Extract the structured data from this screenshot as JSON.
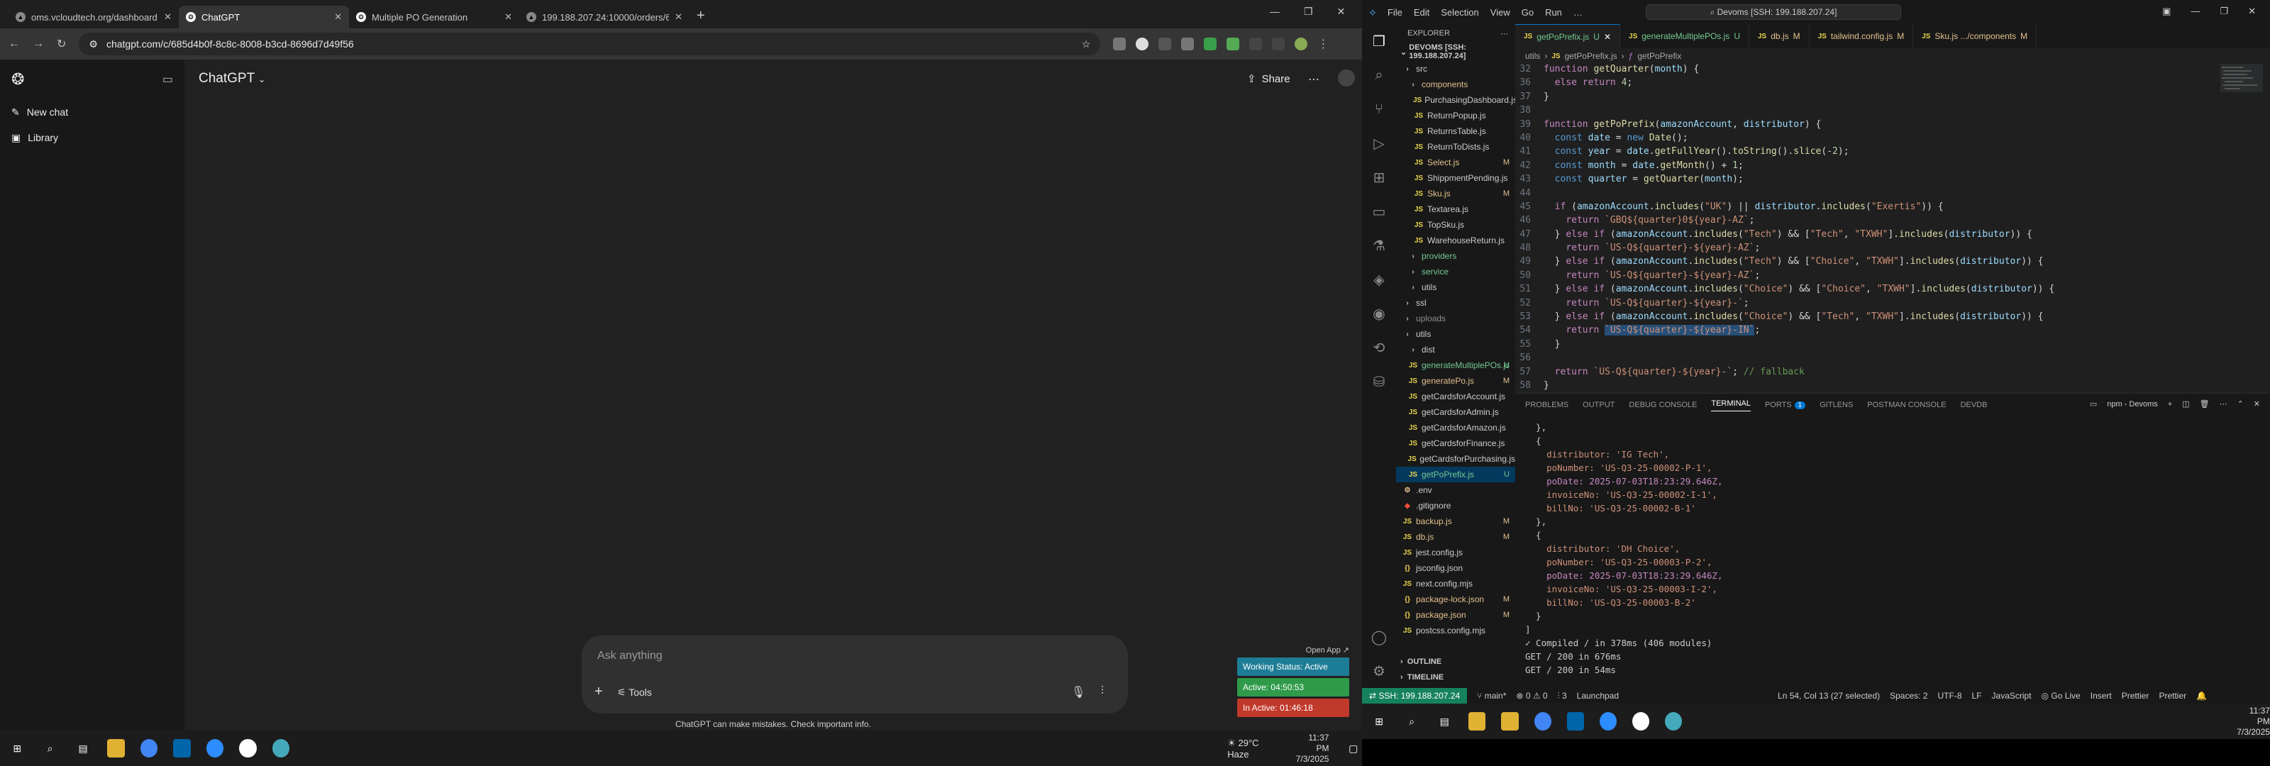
{
  "browser": {
    "tabs": [
      {
        "label": "oms.vcloudtech.org/dashboard",
        "active": false
      },
      {
        "label": "ChatGPT",
        "active": true
      },
      {
        "label": "Multiple PO Generation",
        "active": false
      },
      {
        "label": "199.188.207.24:10000/orders/6",
        "active": false
      }
    ],
    "url": "chatgpt.com/c/685d4b0f-8c8c-8008-b3cd-8696d7d49f56"
  },
  "chatgpt": {
    "sidebar": [
      {
        "label": "New chat"
      },
      {
        "label": "Library"
      }
    ],
    "title": "ChatGPT",
    "share_label": "Share",
    "prompt_placeholder": "Ask anything",
    "tools_label": "Tools",
    "disclaimer": "ChatGPT can make mistakes. Check important info."
  },
  "work_status": {
    "open_app": "Open App",
    "status": "Working Status: Active",
    "active": "Active: 04:50:53",
    "inactive": "In Active: 01:46:18"
  },
  "left_taskbar": {
    "weather": "29°C  Haze",
    "time": "11:37 PM",
    "date": "7/3/2025"
  },
  "vscode": {
    "menu": [
      "File",
      "Edit",
      "Selection",
      "View",
      "Go",
      "Run",
      "…"
    ],
    "search": "Devoms [SSH: 199.188.207.24]",
    "explorer_title": "EXPLORER",
    "workspace": "DEVOMS [SSH: 199.188.207.24]",
    "tree": [
      {
        "label": "src",
        "type": "folder",
        "depth": 0,
        "badge": "",
        "color": "#cccccc"
      },
      {
        "label": "components",
        "type": "folder",
        "depth": 1,
        "badge": "",
        "color": "#e2c08d"
      },
      {
        "label": "PurchasingDashboard.js",
        "type": "js",
        "depth": 2,
        "badge": "",
        "color": "#cccccc"
      },
      {
        "label": "ReturnPopup.js",
        "type": "js",
        "depth": 2,
        "badge": "",
        "color": "#cccccc"
      },
      {
        "label": "ReturnsTable.js",
        "type": "js",
        "depth": 2,
        "badge": "",
        "color": "#cccccc"
      },
      {
        "label": "ReturnToDists.js",
        "type": "js",
        "depth": 2,
        "badge": "",
        "color": "#cccccc"
      },
      {
        "label": "Select.js",
        "type": "js",
        "depth": 2,
        "badge": "M",
        "color": "#e2c08d"
      },
      {
        "label": "ShippmentPending.js",
        "type": "js",
        "depth": 2,
        "badge": "",
        "color": "#cccccc"
      },
      {
        "label": "Sku.js",
        "type": "js",
        "depth": 2,
        "badge": "M",
        "color": "#e2c08d"
      },
      {
        "label": "Textarea.js",
        "type": "js",
        "depth": 2,
        "badge": "",
        "color": "#cccccc"
      },
      {
        "label": "TopSku.js",
        "type": "js",
        "depth": 2,
        "badge": "",
        "color": "#cccccc"
      },
      {
        "label": "WarehouseReturn.js",
        "type": "js",
        "depth": 2,
        "badge": "",
        "color": "#cccccc"
      },
      {
        "label": "providers",
        "type": "folder",
        "depth": 1,
        "badge": "",
        "color": "#73c991"
      },
      {
        "label": "service",
        "type": "folder",
        "depth": 1,
        "badge": "",
        "color": "#73c991"
      },
      {
        "label": "utils",
        "type": "folder",
        "depth": 1,
        "badge": "",
        "color": "#cccccc"
      },
      {
        "label": "ssl",
        "type": "folder",
        "depth": 0,
        "badge": "",
        "color": "#cccccc"
      },
      {
        "label": "uploads",
        "type": "folder",
        "depth": 0,
        "badge": "",
        "color": "#8c8c8c"
      },
      {
        "label": "utils",
        "type": "folder",
        "depth": 0,
        "badge": "",
        "color": "#cccccc"
      },
      {
        "label": "dist",
        "type": "folder",
        "depth": 1,
        "badge": "",
        "color": "#cccccc"
      },
      {
        "label": "generateMultiplePOs.js",
        "type": "js",
        "depth": 1,
        "badge": "U",
        "color": "#73c991"
      },
      {
        "label": "generatePo.js",
        "type": "js",
        "depth": 1,
        "badge": "M",
        "color": "#e2c08d"
      },
      {
        "label": "getCardsforAccount.js",
        "type": "js",
        "depth": 1,
        "badge": "",
        "color": "#cccccc"
      },
      {
        "label": "getCardsforAdmin.js",
        "type": "js",
        "depth": 1,
        "badge": "",
        "color": "#cccccc"
      },
      {
        "label": "getCardsforAmazon.js",
        "type": "js",
        "depth": 1,
        "badge": "",
        "color": "#cccccc"
      },
      {
        "label": "getCardsforFinance.js",
        "type": "js",
        "depth": 1,
        "badge": "",
        "color": "#cccccc"
      },
      {
        "label": "getCardsforPurchasing.js",
        "type": "js",
        "depth": 1,
        "badge": "",
        "color": "#cccccc"
      },
      {
        "label": "getPoPrefix.js",
        "type": "js",
        "depth": 1,
        "badge": "U",
        "color": "#73c991",
        "selected": true
      },
      {
        "label": ".env",
        "type": "env",
        "depth": 0,
        "badge": "",
        "color": "#cccccc"
      },
      {
        "label": ".gitignore",
        "type": "git",
        "depth": 0,
        "badge": "",
        "color": "#cccccc"
      },
      {
        "label": "backup.js",
        "type": "js",
        "depth": 0,
        "badge": "M",
        "color": "#e2c08d"
      },
      {
        "label": "db.js",
        "type": "js",
        "depth": 0,
        "badge": "M",
        "color": "#e2c08d"
      },
      {
        "label": "jest.config.js",
        "type": "js",
        "depth": 0,
        "badge": "",
        "color": "#cccccc"
      },
      {
        "label": "jsconfig.json",
        "type": "json",
        "depth": 0,
        "badge": "",
        "color": "#cccccc"
      },
      {
        "label": "next.config.mjs",
        "type": "js",
        "depth": 0,
        "badge": "",
        "color": "#cccccc"
      },
      {
        "label": "package-lock.json",
        "type": "json",
        "depth": 0,
        "badge": "M",
        "color": "#e2c08d"
      },
      {
        "label": "package.json",
        "type": "json",
        "depth": 0,
        "badge": "M",
        "color": "#e2c08d"
      },
      {
        "label": "postcss.config.mjs",
        "type": "js",
        "depth": 0,
        "badge": "",
        "color": "#cccccc"
      }
    ],
    "outline": "OUTLINE",
    "timeline": "TIMELINE",
    "tabs": [
      {
        "label": "getPoPrefix.js",
        "badge": "U",
        "active": true
      },
      {
        "label": "generateMultiplePOs.js",
        "badge": "U",
        "active": false
      },
      {
        "label": "db.js",
        "badge": "M",
        "active": false
      },
      {
        "label": "tailwind.config.js",
        "badge": "M",
        "active": false
      },
      {
        "label": "Sku.js .../components",
        "badge": "M",
        "active": false
      }
    ],
    "breadcrumb": [
      "utils",
      "getPoPrefix.js",
      "getPoPrefix"
    ],
    "code": [
      {
        "n": "32",
        "html": "<span class='kw'>function</span> <span class='fn'>getQuarter</span>(<span class='vr'>month</span>) {"
      },
      {
        "n": "36",
        "html": "  <span class='kw'>else return</span> <span class='nm'>4</span>;"
      },
      {
        "n": "37",
        "html": "}"
      },
      {
        "n": "38",
        "html": ""
      },
      {
        "n": "39",
        "html": "<span class='kw'>function</span> <span class='fn'>getPoPrefix</span>(<span class='vr'>amazonAccount</span>, <span class='vr'>distributor</span>) {"
      },
      {
        "n": "40",
        "html": "  <span class='bk'>const</span> <span class='vr'>date</span> = <span class='bk'>new</span> <span class='fn'>Date</span>();"
      },
      {
        "n": "41",
        "html": "  <span class='bk'>const</span> <span class='vr'>year</span> = <span class='vr'>date</span>.<span class='fn'>getFullYear</span>().<span class='fn'>toString</span>().<span class='fn'>slice</span>(<span class='nm'>-2</span>);"
      },
      {
        "n": "42",
        "html": "  <span class='bk'>const</span> <span class='vr'>month</span> = <span class='vr'>date</span>.<span class='fn'>getMonth</span>() + <span class='nm'>1</span>;"
      },
      {
        "n": "43",
        "html": "  <span class='bk'>const</span> <span class='vr'>quarter</span> = <span class='fn'>getQuarter</span>(<span class='vr'>month</span>);"
      },
      {
        "n": "44",
        "html": ""
      },
      {
        "n": "45",
        "html": "  <span class='kw'>if</span> (<span class='vr'>amazonAccount</span>.<span class='fn'>includes</span>(<span class='st'>\"UK\"</span>) || <span class='vr'>distributor</span>.<span class='fn'>includes</span>(<span class='st'>\"Exertis\"</span>)) {"
      },
      {
        "n": "46",
        "html": "    <span class='kw'>return</span> <span class='st'>`GBQ${quarter}0${year}-AZ`</span>;"
      },
      {
        "n": "47",
        "html": "  } <span class='kw'>else if</span> (<span class='vr'>amazonAccount</span>.<span class='fn'>includes</span>(<span class='st'>\"Tech\"</span>) &amp;&amp; [<span class='st'>\"Tech\"</span>, <span class='st'>\"TXWH\"</span>].<span class='fn'>includes</span>(<span class='vr'>distributor</span>)) {"
      },
      {
        "n": "48",
        "html": "    <span class='kw'>return</span> <span class='st'>`US-Q${quarter}-${year}-AZ`</span>;"
      },
      {
        "n": "49",
        "html": "  } <span class='kw'>else if</span> (<span class='vr'>amazonAccount</span>.<span class='fn'>includes</span>(<span class='st'>\"Tech\"</span>) &amp;&amp; [<span class='st'>\"Choice\"</span>, <span class='st'>\"TXWH\"</span>].<span class='fn'>includes</span>(<span class='vr'>distributor</span>)) {"
      },
      {
        "n": "50",
        "html": "    <span class='kw'>return</span> <span class='st'>`US-Q${quarter}-${year}-AZ`</span>;"
      },
      {
        "n": "51",
        "html": "  } <span class='kw'>else if</span> (<span class='vr'>amazonAccount</span>.<span class='fn'>includes</span>(<span class='st'>\"Choice\"</span>) &amp;&amp; [<span class='st'>\"Choice\"</span>, <span class='st'>\"TXWH\"</span>].<span class='fn'>includes</span>(<span class='vr'>distributor</span>)) {"
      },
      {
        "n": "52",
        "html": "    <span class='kw'>return</span> <span class='st'>`US-Q${quarter}-${year}-`</span>;"
      },
      {
        "n": "53",
        "html": "  } <span class='kw'>else if</span> (<span class='vr'>amazonAccount</span>.<span class='fn'>includes</span>(<span class='st'>\"Choice\"</span>) &amp;&amp; [<span class='st'>\"Tech\"</span>, <span class='st'>\"TXWH\"</span>].<span class='fn'>includes</span>(<span class='vr'>distributor</span>)) {"
      },
      {
        "n": "54",
        "html": "    <span class='kw'>return</span> <span class='st' style='background:#264f78'>`US-Q${quarter}-${year}-IN`</span>;"
      },
      {
        "n": "55",
        "html": "  }"
      },
      {
        "n": "56",
        "html": ""
      },
      {
        "n": "57",
        "html": "  <span class='kw'>return</span> <span class='st'>`US-Q${quarter}-${year}-`</span>; <span class='cm'>// fallback</span>"
      },
      {
        "n": "58",
        "html": "}"
      }
    ],
    "panel_tabs": [
      "PROBLEMS",
      "OUTPUT",
      "DEBUG CONSOLE",
      "TERMINAL",
      "PORTS",
      "GITLENS",
      "POSTMAN CONSOLE",
      "DEVDB"
    ],
    "ports_count": "1",
    "terminal_label": "npm - Devoms",
    "terminal": [
      "  },",
      "  {",
      "    distributor: 'IG Tech',",
      "    poNumber: 'US-Q3-25-00002-P-1',",
      "    poDate: 2025-07-03T18:23:29.646Z,",
      "    invoiceNo: 'US-Q3-25-00002-I-1',",
      "    billNo: 'US-Q3-25-00002-B-1'",
      "  },",
      "  {",
      "    distributor: 'DH Choice',",
      "    poNumber: 'US-Q3-25-00003-P-2',",
      "    poDate: 2025-07-03T18:23:29.646Z,",
      "    invoiceNo: 'US-Q3-25-00003-I-2',",
      "    billNo: 'US-Q3-25-00003-B-2'",
      "  }",
      "]",
      "✓ Compiled / in 378ms (406 modules)",
      "GET / 200 in 676ms",
      "GET / 200 in 54ms"
    ],
    "status": {
      "ssh": "SSH: 199.188.207.24",
      "branch": "main*",
      "problems": "0 ⚠ 0",
      "ports": "3",
      "launchpad": "Launchpad",
      "position": "Ln 54, Col 13 (27 selected)",
      "spaces": "Spaces: 2",
      "encoding": "UTF-8",
      "eol": "LF",
      "language": "JavaScript",
      "golive": "Go Live",
      "insert": "Insert",
      "prettier": "Prettier"
    }
  },
  "right_taskbar": {
    "time": "11:37 PM",
    "date": "7/3/2025"
  }
}
